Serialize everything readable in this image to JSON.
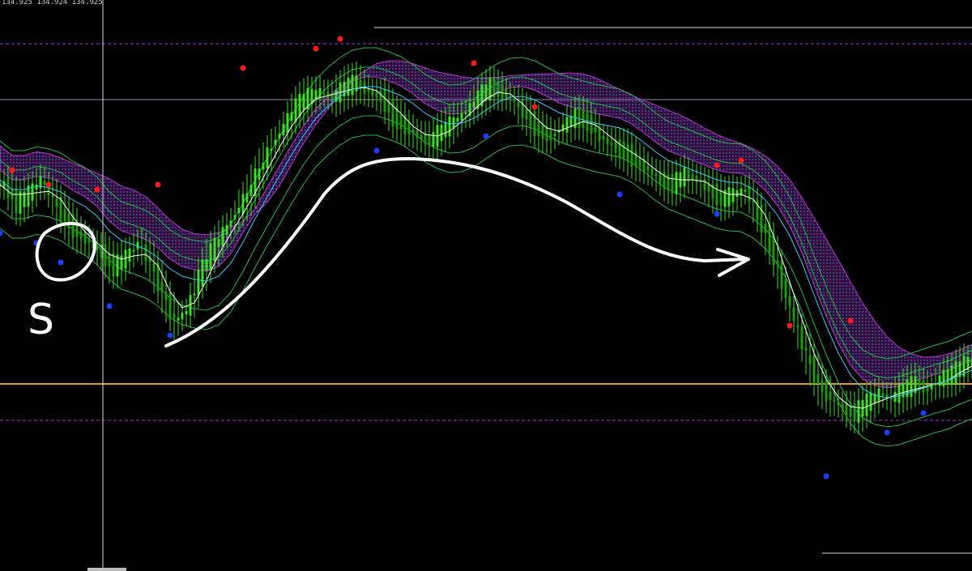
{
  "window": {
    "ohlc_readout": "134.925 134.924 134.925"
  },
  "colors": {
    "background": "#000000",
    "candle": "#39e21f",
    "candle_dark": "#1f9a10",
    "envelope": "#1fb84a",
    "fast_ma": "#ffffff",
    "mid_ma": "#2fc9ff",
    "cloud": "#c22bd6",
    "cloud_dots": "#3aa6ff",
    "fractal_high": "#ff1a1a",
    "fractal_low": "#1a3dff",
    "level_orange": "#e89a1f",
    "level_dash": "#9a3de0",
    "level_grey": "#8a8ab0",
    "level_white": "#d9d9d9",
    "drawing": "#ffffff"
  },
  "chart_data": {
    "type": "line",
    "series": [
      {
        "role": "price",
        "style": "candlestick",
        "x": [
          0,
          1,
          2,
          3,
          4,
          5,
          6,
          7,
          8,
          9,
          10,
          11,
          12,
          13,
          14,
          15,
          16,
          17,
          18,
          19,
          20,
          21,
          22,
          23,
          24,
          25,
          26,
          27,
          28,
          29,
          30,
          31,
          32,
          33,
          34,
          35,
          36,
          37,
          38,
          39,
          40,
          41,
          42,
          43,
          44,
          45,
          46,
          47,
          48,
          49,
          50,
          51,
          52,
          53,
          54,
          55,
          56,
          57,
          58,
          59,
          60,
          61,
          62,
          63,
          64,
          65,
          66,
          67,
          68,
          69,
          70,
          71,
          72,
          73,
          74,
          75,
          76,
          77,
          78,
          79,
          80
        ],
        "values": [
          0.72,
          0.68,
          0.7,
          0.73,
          0.69,
          0.65,
          0.62,
          0.6,
          0.58,
          0.55,
          0.57,
          0.6,
          0.56,
          0.5,
          0.44,
          0.46,
          0.53,
          0.58,
          0.62,
          0.66,
          0.7,
          0.75,
          0.8,
          0.84,
          0.88,
          0.9,
          0.91,
          0.9,
          0.92,
          0.93,
          0.91,
          0.9,
          0.86,
          0.84,
          0.82,
          0.81,
          0.83,
          0.85,
          0.87,
          0.9,
          0.92,
          0.91,
          0.89,
          0.86,
          0.83,
          0.82,
          0.84,
          0.86,
          0.85,
          0.82,
          0.8,
          0.79,
          0.77,
          0.75,
          0.73,
          0.72,
          0.74,
          0.73,
          0.71,
          0.69,
          0.7,
          0.71,
          0.66,
          0.6,
          0.52,
          0.44,
          0.37,
          0.31,
          0.28,
          0.26,
          0.25,
          0.27,
          0.29,
          0.28,
          0.3,
          0.31,
          0.3,
          0.32,
          0.33,
          0.35,
          0.36
        ]
      }
    ],
    "fractal_highs": [
      [
        1,
        0.75
      ],
      [
        4,
        0.72
      ],
      [
        8,
        0.71
      ],
      [
        13,
        0.72
      ],
      [
        20,
        0.96
      ],
      [
        26,
        1.0
      ],
      [
        28,
        1.02
      ],
      [
        39,
        0.97
      ],
      [
        44,
        0.88
      ],
      [
        59,
        0.76
      ],
      [
        61,
        0.77
      ],
      [
        65,
        0.43
      ],
      [
        70,
        0.44
      ]
    ],
    "fractal_lows": [
      [
        0,
        0.62
      ],
      [
        3,
        0.6
      ],
      [
        5,
        0.56
      ],
      [
        9,
        0.47
      ],
      [
        14,
        0.41
      ],
      [
        31,
        0.79
      ],
      [
        40,
        0.82
      ],
      [
        51,
        0.7
      ],
      [
        59,
        0.66
      ],
      [
        68,
        0.12
      ],
      [
        73,
        0.21
      ],
      [
        76,
        0.25
      ]
    ],
    "horizontal_levels": [
      {
        "style": "dashed",
        "y": 1.01
      },
      {
        "style": "solid_grey",
        "y": 0.895
      },
      {
        "style": "solid_orange",
        "y": 0.31
      },
      {
        "style": "dashed",
        "y": 0.235
      }
    ],
    "drawing_label": "S",
    "ylim": [
      0.0,
      1.05
    ],
    "xlim": [
      0,
      80
    ],
    "grid": false,
    "legend": "none"
  }
}
